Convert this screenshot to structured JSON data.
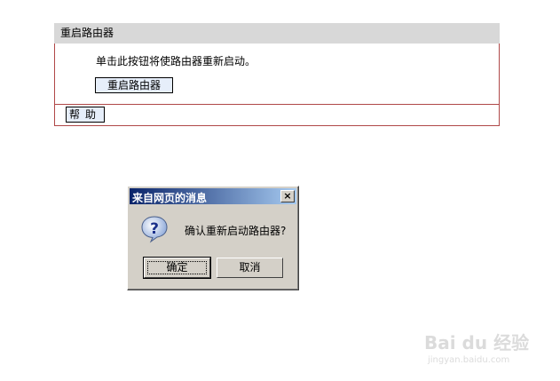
{
  "panel": {
    "title": "重启路由器",
    "description": "单击此按钮将使路由器重新启动。",
    "reboot_button": "重启路由器",
    "help_button": "帮助"
  },
  "dialog": {
    "title": "来自网页的消息",
    "close_glyph": "×",
    "message": "确认重新启动路由器?",
    "ok_button": "确定",
    "cancel_button": "取消"
  },
  "watermark": {
    "text": "Bai du 经验",
    "sub": "jingyan.baidu.com"
  },
  "colors": {
    "panel_border": "#b04848",
    "panel_header": "#d8d8d8",
    "dialog_title_start": "#0a246a",
    "dialog_title_end": "#a6caf0",
    "dialog_face": "#d4d0c8"
  }
}
